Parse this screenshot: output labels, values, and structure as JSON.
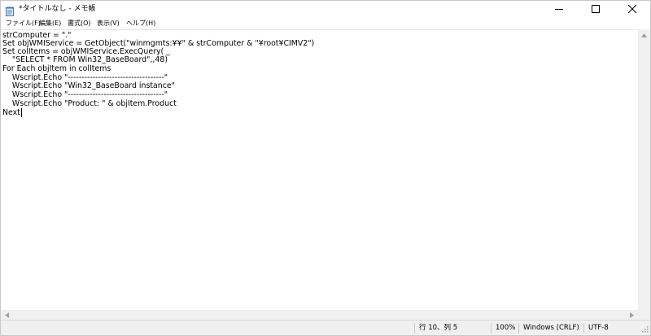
{
  "window": {
    "title": "*タイトルなし - メモ帳"
  },
  "menu": {
    "items": [
      {
        "label": "ファイル(F)"
      },
      {
        "label": "編集(E)"
      },
      {
        "label": "書式(O)"
      },
      {
        "label": "表示(V)"
      },
      {
        "label": "ヘルプ(H)"
      }
    ]
  },
  "editor": {
    "lines": [
      "strComputer = \".\"",
      "Set objWMIService = GetObject(\"winmgmts:¥¥\" & strComputer & \"¥root¥CIMV2\")",
      "Set colItems = objWMIService.ExecQuery( _",
      "    \"SELECT * FROM Win32_BaseBoard\",,48)",
      "For Each objItem in colItems",
      "    Wscript.Echo \"-----------------------------------\"",
      "    Wscript.Echo \"Win32_BaseBoard instance\"",
      "    Wscript.Echo \"-----------------------------------\"",
      "    Wscript.Echo \"Product: \" & objItem.Product",
      "Next"
    ]
  },
  "statusbar": {
    "position": "行 10、列 5",
    "zoom": "100%",
    "line_ending": "Windows (CRLF)",
    "encoding": "UTF-8"
  },
  "icons": {
    "app": "notepad-icon",
    "minimize": "minimize-icon",
    "maximize": "maximize-icon",
    "close": "close-icon"
  },
  "colors": {
    "chrome": "#f0f0f0",
    "text": "#000000",
    "background": "#ffffff"
  }
}
